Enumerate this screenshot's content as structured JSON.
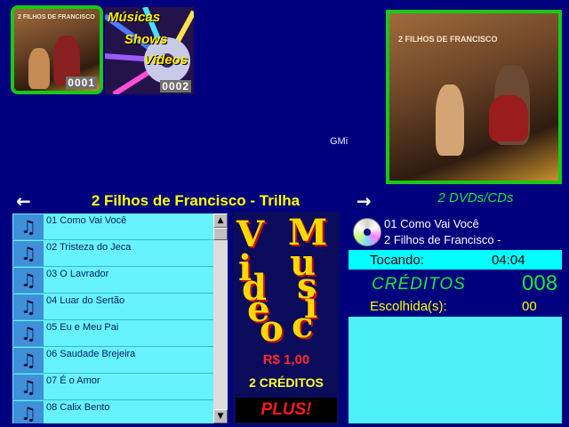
{
  "albums": [
    {
      "number": "0001",
      "cover_text": "2 FILHOS DE FRANCISCO",
      "selected": true
    },
    {
      "number": "0002",
      "menu_words": [
        "Músicas",
        "Shows",
        "Vídeos"
      ],
      "selected": false
    }
  ],
  "cover": {
    "title_text": "2 FILHOS DE FRANCISCO"
  },
  "watermark": "GMi",
  "album_title": "2 Filhos de Francisco - Trilha",
  "disc_count_label": "2 DVDs/CDs",
  "tracks": [
    "01 Como Vai Você",
    "02 Tristeza do Jeca",
    "03 O Lavrador",
    "04 Luar do Sertão",
    "05 Eu e Meu Pai",
    "06 Saudade Brejeira",
    "07 É o Amor",
    "08 Calix Bento"
  ],
  "logo": {
    "line1": "VMusic",
    "line2": "Video",
    "letters": [
      "V",
      "M",
      "u",
      "s",
      "i",
      "c",
      "V",
      "i",
      "d",
      "e",
      "o"
    ]
  },
  "promo": {
    "price": "R$ 1,00",
    "credits": "2 CRÉDITOS",
    "plus": "PLUS!"
  },
  "now_playing": {
    "song": "01 Como Vai Você",
    "artist": "2 Filhos de Francisco -",
    "playing_label": "Tocando:",
    "time": "04:04",
    "credits_label": "CRÉDITOS",
    "credits_value": "008",
    "chosen_label": "Escolhida(s):",
    "chosen_value": "00"
  },
  "nav": {
    "prev_icon": "arrow-left-icon",
    "next_icon": "arrow-right-icon"
  },
  "colors": {
    "background": "#00007f",
    "accent_green": "#19c914",
    "title_yellow": "#ffff00",
    "list_cyan": "#66f3ff",
    "price_red": "#ff2a2a"
  }
}
